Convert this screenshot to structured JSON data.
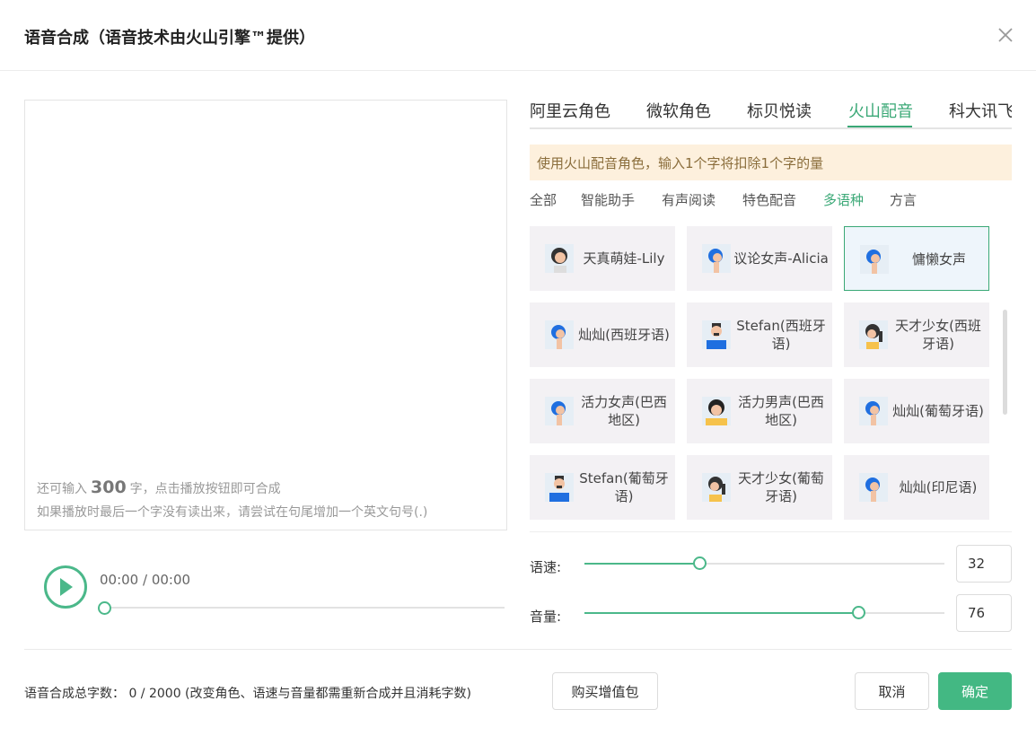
{
  "dialog": {
    "title": "语音合成（语音技术由火山引擎™提供）",
    "close_icon": "close-icon"
  },
  "editor": {
    "remaining_prefix": "还可输入",
    "remaining_count": "300",
    "remaining_suffix": "字，点击播放按钮即可合成",
    "tip": "如果播放时最后一个字没有读出来，请尝试在句尾增加一个英文句号(.)"
  },
  "player": {
    "play_icon": "play-icon",
    "time": "00:00 / 00:00",
    "progress": 0
  },
  "tabs": [
    {
      "label": "阿里云角色",
      "active": false
    },
    {
      "label": "微软角色",
      "active": false
    },
    {
      "label": "标贝悦读",
      "active": false
    },
    {
      "label": "火山配音",
      "active": true
    },
    {
      "label": "科大讯飞",
      "active": false
    }
  ],
  "notice": "使用火山配音角色，输入1个字将扣除1个字的量",
  "filters": [
    {
      "label": "全部",
      "active": false
    },
    {
      "label": "智能助手",
      "active": false
    },
    {
      "label": "有声阅读",
      "active": false
    },
    {
      "label": "特色配音",
      "active": false
    },
    {
      "label": "多语种",
      "active": true
    },
    {
      "label": "方言",
      "active": false
    }
  ],
  "voices": [
    {
      "name": "天真萌娃-Lily",
      "avatar": "girl-avatar-icon",
      "selected": false
    },
    {
      "name": "议论女声-Alicia",
      "avatar": "woman-avatar-icon",
      "selected": false
    },
    {
      "name": "慵懒女声",
      "avatar": "woman-avatar-icon",
      "selected": true
    },
    {
      "name": "灿灿(西班牙语)",
      "avatar": "woman-avatar-icon",
      "selected": false
    },
    {
      "name": "Stefan(西班牙语)",
      "avatar": "man-avatar-icon",
      "selected": false
    },
    {
      "name": "天才少女(西班牙语)",
      "avatar": "girl-ponytail-avatar-icon",
      "selected": false
    },
    {
      "name": "活力女声(巴西地区)",
      "avatar": "woman-avatar-icon",
      "selected": false
    },
    {
      "name": "活力男声(巴西地区)",
      "avatar": "young-man-avatar-icon",
      "selected": false
    },
    {
      "name": "灿灿(葡萄牙语)",
      "avatar": "woman-avatar-icon",
      "selected": false
    },
    {
      "name": "Stefan(葡萄牙语)",
      "avatar": "man-avatar-icon",
      "selected": false
    },
    {
      "name": "天才少女(葡萄牙语)",
      "avatar": "girl-ponytail-avatar-icon",
      "selected": false
    },
    {
      "name": "灿灿(印尼语)",
      "avatar": "woman-avatar-icon",
      "selected": false
    }
  ],
  "speed": {
    "label": "语速:",
    "value": "32",
    "min": 0,
    "max": 100
  },
  "volume": {
    "label": "音量:",
    "value": "76",
    "min": 0,
    "max": 100
  },
  "footer": {
    "total_text": "语音合成总字数：  0 / 2000  (改变角色、语速与音量都需重新合成并且消耗字数)",
    "buy_label": "购买增值包",
    "cancel_label": "取消",
    "ok_label": "确定"
  },
  "colors": {
    "accent": "#3aa876",
    "button": "#43b883",
    "notice_bg": "#fdf0dd"
  }
}
